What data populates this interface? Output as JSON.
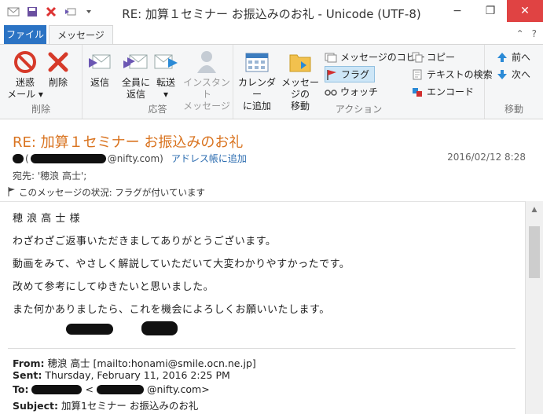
{
  "window": {
    "title": "RE: 加算１セミナー お振込みのお礼 - Unicode (UTF-8)",
    "min_glyph": "−",
    "max_glyph": "❐",
    "close_glyph": "✕"
  },
  "tabs": {
    "file": "ファイル",
    "message": "メッセージ",
    "help_glyph": "?",
    "collapse_glyph": "⌃"
  },
  "ribbon": {
    "groups": {
      "delete": "削除",
      "respond": "応答",
      "actions": "アクション",
      "move": "移動"
    },
    "junk": {
      "line1": "迷惑",
      "line2": "メール ▾"
    },
    "delete": "削除",
    "reply": "返信",
    "reply_all": {
      "line1": "全員に",
      "line2": "返信"
    },
    "forward": {
      "line1": "転送",
      "line2": "▾"
    },
    "instant": {
      "line1": "インスタント",
      "line2": "メッセージ"
    },
    "calendar": {
      "line1": "カレンダー",
      "line2": "に追加"
    },
    "move_to": {
      "line1": "メッセージの",
      "line2": "移動"
    },
    "copy_message": "メッセージのコピー",
    "flag": "フラグ",
    "watch": "ウォッチ",
    "copy": "コピー",
    "find_text": "テキストの検索",
    "encode": "エンコード",
    "prev": "前へ",
    "next": "次へ"
  },
  "message": {
    "subject": "RE: 加算１セミナー お振込みのお礼",
    "sender_suffix": "@nifty.com)",
    "add_to_contacts": "アドレス帳に追加",
    "date": "2016/02/12 8:28",
    "to": "宛先: '穂浪 高士';",
    "status": "このメッセージの状況: フラグが付いています"
  },
  "body": {
    "lines": [
      "穂 浪 高 士   様",
      "わざわざご返事いただきましてありがとうございます。",
      "動画をみて、やさしく解説していただいて大変わかりやすかったです。",
      "改めて参考にしてゆきたいと思いました。",
      "また何かありましたら、これを機会によろしくお願いいたします。"
    ],
    "forwarded": {
      "from_label": "From:",
      "from_value": "穂浪 高士 [mailto:honami@smile.ocn.ne.jp]",
      "sent_label": "Sent:",
      "sent_value": "Thursday, February 11, 2016 2:25 PM",
      "to_label": "To:",
      "to_suffix": "@nifty.com>",
      "subject_label": "Subject:",
      "subject_value": "加算1セミナー お振込みのお礼"
    }
  },
  "colors": {
    "accent": "#2b73c4",
    "subject": "#d9731f",
    "link": "#2b6cb0",
    "close": "#e04343"
  }
}
